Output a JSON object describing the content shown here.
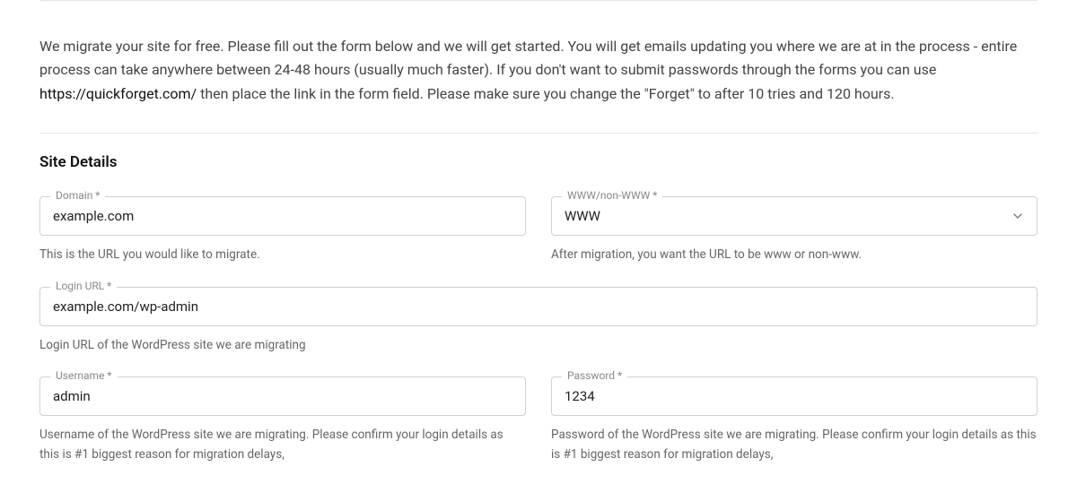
{
  "intro": {
    "part1": "We migrate your site for free. Please fill out the form below and we will get started. You will get emails updating you where we are at in the process - entire process can take anywhere between 24-48 hours (usually much faster). If you don't want to submit passwords through the forms you can use ",
    "link_text": "https://quickforget.com/",
    "part2": " then place the link in the form field. Please make sure you change the \"Forget\" to after 10 tries and 120 hours."
  },
  "section_title": "Site Details",
  "fields": {
    "domain": {
      "label": "Domain *",
      "value": "example.com",
      "helper": "This is the URL you would like to migrate."
    },
    "www": {
      "label": "WWW/non-WWW *",
      "value": "WWW",
      "helper": "After migration, you want the URL to be www or non-www."
    },
    "login_url": {
      "label": "Login URL *",
      "value": "example.com/wp-admin",
      "helper": "Login URL of the WordPress site we are migrating"
    },
    "username": {
      "label": "Username *",
      "value": "admin",
      "helper": "Username of the WordPress site we are migrating. Please confirm your login details as this is #1 biggest reason for migration delays,"
    },
    "password": {
      "label": "Password *",
      "value": "1234",
      "helper": "Password of the WordPress site we are migrating. Please confirm your login details as this is #1 biggest reason for migration delays,"
    }
  }
}
